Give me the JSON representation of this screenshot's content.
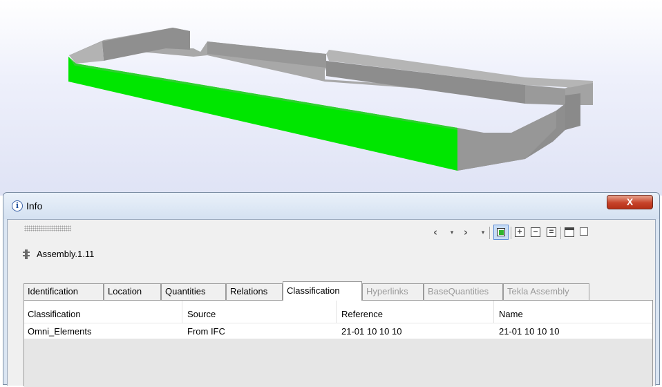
{
  "window": {
    "title": "Info",
    "close_label": "X"
  },
  "toolbar": {
    "icons": [
      "back-icon",
      "back-dropdown-icon",
      "forward-icon",
      "forward-dropdown-icon",
      "select-in-model-icon",
      "expand-all-icon",
      "collapse-all-icon",
      "list-icon",
      "float-window-icon",
      "maximize-icon"
    ]
  },
  "object": {
    "name": "Assembly.1.11"
  },
  "tabs": [
    {
      "label": "Identification",
      "state": "normal"
    },
    {
      "label": "Location",
      "state": "normal"
    },
    {
      "label": "Quantities",
      "state": "normal"
    },
    {
      "label": "Relations",
      "state": "normal"
    },
    {
      "label": "Classification",
      "state": "active"
    },
    {
      "label": "Hyperlinks",
      "state": "disabled"
    },
    {
      "label": "BaseQuantities",
      "state": "disabled"
    },
    {
      "label": "Tekla Assembly",
      "state": "disabled"
    }
  ],
  "grid": {
    "columns": [
      "Classification",
      "Source",
      "Reference",
      "Name"
    ],
    "rows": [
      [
        "Omni_Elements",
        "From IFC",
        "21-01 10 10 10",
        "21-01 10 10 10"
      ]
    ]
  },
  "colors": {
    "selected_element": "#00e600",
    "wall": "#9c9c9c",
    "close_button": "#c7432a"
  }
}
